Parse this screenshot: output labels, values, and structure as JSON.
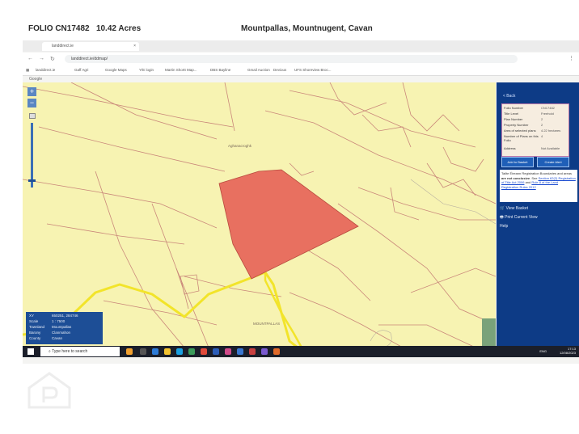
{
  "header": {
    "folio": "FOLIO CN17482",
    "acres": "10.42 Acres",
    "location": "Mountpallas, Mountnugent, Cavan"
  },
  "browser": {
    "tab_title": "landdirect.ie",
    "url": "landdirect.ie/ddmap/",
    "bookmarks": [
      "landdirect.ie",
      "Gaff Agri",
      "Google Maps",
      "Y/E login",
      "Martin Shortt Map...",
      "DBS Bayline",
      "Gmail Auction",
      "Devious",
      "UFS Shoreview Broc..."
    ]
  },
  "map": {
    "google_label": "Google",
    "townland_label_1": "Aghanacroghk",
    "townland_label_2": "MOUNTPALLAS",
    "edge_label": "BALLYB",
    "zoom_in": "+",
    "zoom_out": "−",
    "plot_color": "#e87060",
    "road_color": "#f2e42a",
    "base_color": "#f7f3b2",
    "line_color": "#c9877a"
  },
  "info_box": {
    "rows": [
      {
        "label": "XY",
        "value": "650251, 284746"
      },
      {
        "label": "Scale",
        "value": "1 : 7500"
      },
      {
        "label": "Townland",
        "value": "Mountpallas"
      },
      {
        "label": "Barony",
        "value": "Clanmahon"
      },
      {
        "label": "County",
        "value": "Cavan"
      }
    ]
  },
  "panel": {
    "back": "< Back",
    "rows": [
      {
        "label": "Folio Number",
        "value": "CN17482"
      },
      {
        "label": "Title Level",
        "value": "Freehold"
      },
      {
        "label": "Plan Number",
        "value": "2"
      },
      {
        "label": "Property Number",
        "value": "2"
      },
      {
        "label": "Area of selected plans",
        "value": "4.22 hectares"
      },
      {
        "label": "Number of Plans on this Folio",
        "value": "4"
      },
      {
        "label": "Address",
        "value": "Not Available"
      }
    ],
    "btn_basket": "Add to Basket",
    "btn_alert": "Create Alert",
    "note_a": "Tailte Éireann Registration Boundaries and areas ",
    "note_b": "are not conclusive",
    "note_c": ". See ",
    "note_d": "Section 62(2) Registration of Title Act 2006",
    "note_e": " and ",
    "note_f": "Rule 8 of the Land Registration Rules 2012",
    "links": [
      "View Basket",
      "Print Current View",
      "Help"
    ]
  },
  "taskbar": {
    "search": "Type here to search",
    "lang": "ENG",
    "time": "17:13",
    "date": "12/08/2023"
  }
}
